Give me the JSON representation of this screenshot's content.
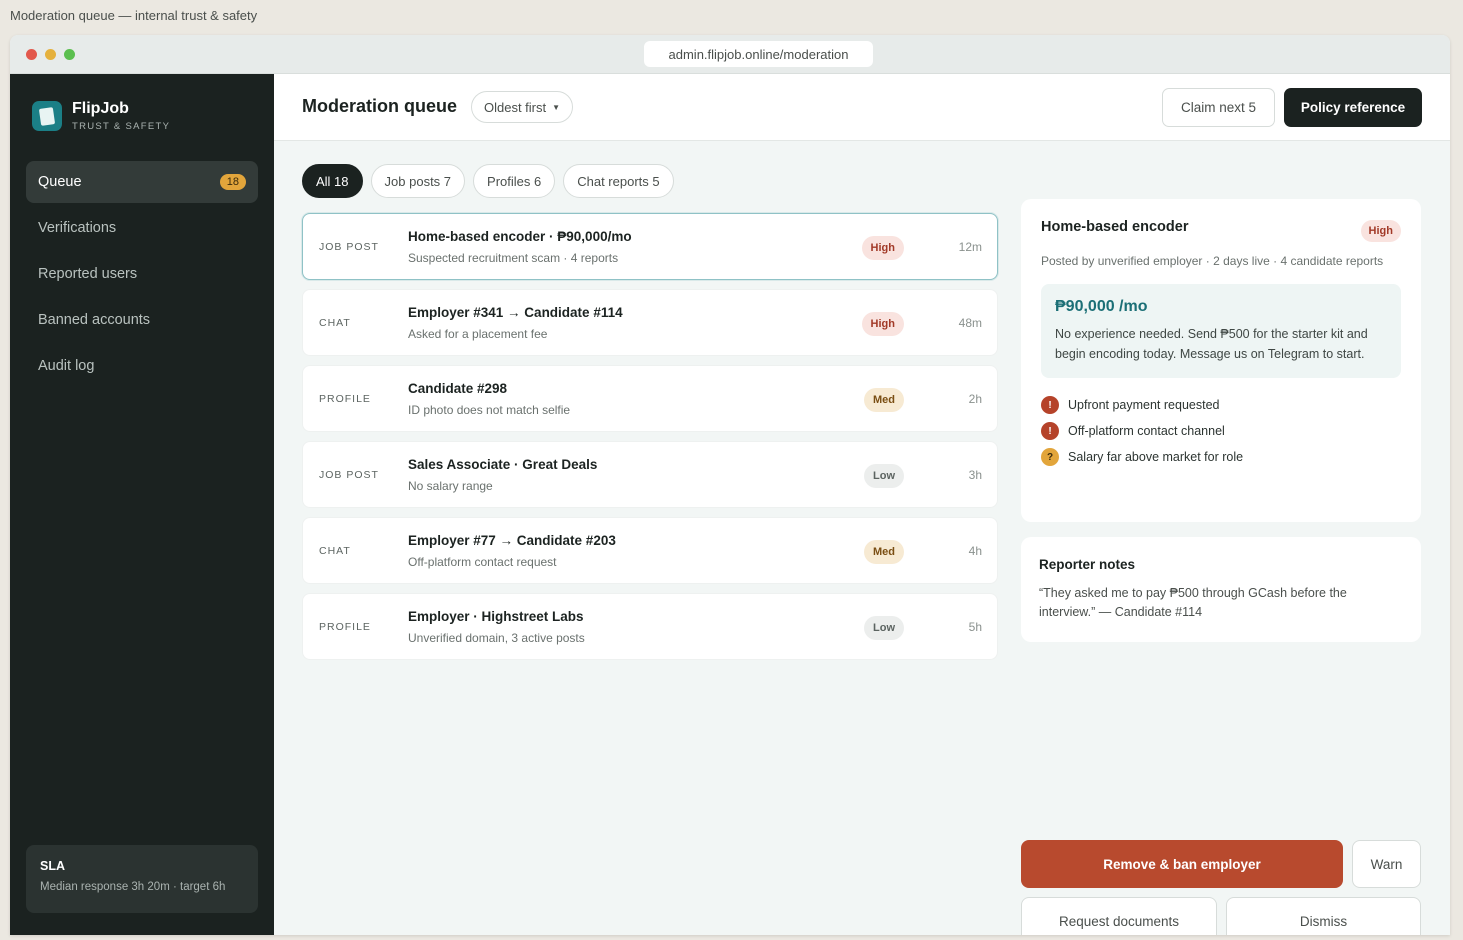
{
  "page_caption": "Moderation queue — internal trust & safety",
  "browser": {
    "url": "admin.flipjob.online/moderation"
  },
  "brand": {
    "name": "FlipJob",
    "subtitle": "TRUST & SAFETY",
    "logo_icon": "card-stack-icon"
  },
  "sidebar": {
    "items": [
      {
        "label": "Queue",
        "badge": "18",
        "active": true
      },
      {
        "label": "Verifications"
      },
      {
        "label": "Reported users"
      },
      {
        "label": "Banned accounts"
      },
      {
        "label": "Audit log"
      }
    ],
    "sla": {
      "title": "SLA",
      "text": "Median response 3h 20m · target 6h"
    }
  },
  "header": {
    "title": "Moderation queue",
    "sort_label": "Oldest first",
    "claim_label": "Claim next 5",
    "policy_label": "Policy reference"
  },
  "filters": [
    {
      "label": "All 18",
      "active": true
    },
    {
      "label": "Job posts 7"
    },
    {
      "label": "Profiles 6"
    },
    {
      "label": "Chat reports 5"
    }
  ],
  "queue": [
    {
      "type": "JOB POST",
      "title": "Home-based encoder · ₱90,000/mo",
      "subtitle": "Suspected recruitment scam · 4 reports",
      "priority": "High",
      "age": "12m",
      "selected": true
    },
    {
      "type": "CHAT",
      "title": "Employer #341 → Candidate #114",
      "subtitle": "Asked for a placement fee",
      "priority": "High",
      "age": "48m"
    },
    {
      "type": "PROFILE",
      "title": "Candidate #298",
      "subtitle": "ID photo does not match selfie",
      "priority": "Med",
      "age": "2h"
    },
    {
      "type": "JOB POST",
      "title": "Sales Associate · Great Deals",
      "subtitle": "No salary range",
      "priority": "Low",
      "age": "3h"
    },
    {
      "type": "CHAT",
      "title": "Employer #77 → Candidate #203",
      "subtitle": "Off-platform contact request",
      "priority": "Med",
      "age": "4h"
    },
    {
      "type": "PROFILE",
      "title": "Employer · Highstreet Labs",
      "subtitle": "Unverified domain, 3 active posts",
      "priority": "Low",
      "age": "5h"
    }
  ],
  "detail": {
    "title": "Home-based encoder",
    "priority": "High",
    "meta": "Posted by unverified employer · 2 days live · 4 candidate reports",
    "price": "₱90,000 /mo",
    "body": "No experience needed. Send ₱500 for the starter kit and begin encoding today. Message us on Telegram to start.",
    "flags": [
      {
        "icon": "!",
        "severity": "bad",
        "text": "Upfront payment requested"
      },
      {
        "icon": "!",
        "severity": "bad",
        "text": "Off-platform contact channel"
      },
      {
        "icon": "?",
        "severity": "warn",
        "text": "Salary far above market for role"
      }
    ]
  },
  "notes": {
    "title": "Reporter notes",
    "text": "“They asked me to pay ₱500 through GCash before the interview.” — Candidate #114"
  },
  "actions": {
    "ban": "Remove & ban employer",
    "warn": "Warn",
    "request_docs": "Request documents",
    "dismiss": "Dismiss"
  },
  "colors": {
    "sidebar_bg": "#1b2220",
    "accent_teal": "#1b6f76",
    "danger": "#b84a2e",
    "warning": "#e2a53b"
  }
}
